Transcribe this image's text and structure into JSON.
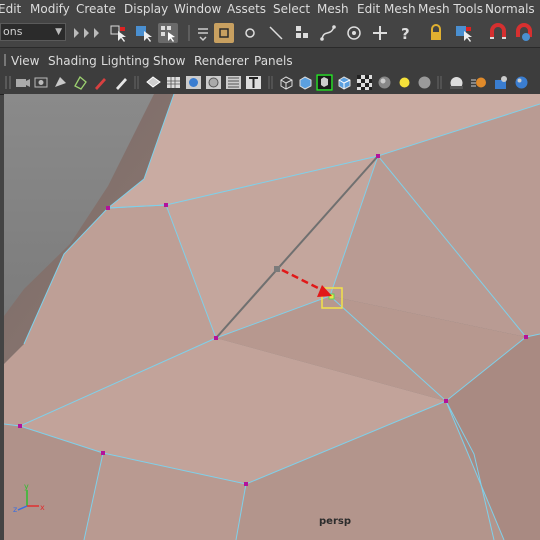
{
  "menu": [
    "Edit",
    "Modify",
    "Create",
    "Display",
    "Window",
    "Assets",
    "Select",
    "Mesh",
    "Edit Mesh",
    "Mesh Tools",
    "Normals"
  ],
  "mode_selector": {
    "value": "ons"
  },
  "panel_menu": [
    "View",
    "Shading",
    "Lighting",
    "Show",
    "Renderer",
    "Panels"
  ],
  "camera_label": "persp",
  "colors": {
    "selection_highlight": "#f2e24a",
    "annotation_arrow": "#e11818",
    "wire": "#7fd0ea",
    "vertex": "#b3129c",
    "mesh": "#bfa097"
  },
  "icons": {
    "shelf": [
      "select-tool-icon",
      "lasso-tool-icon",
      "paint-select-icon",
      "snap-grid-icon",
      "snap-curve-icon",
      "snap-point-icon",
      "make-live-icon",
      "history-icon",
      "render-icon",
      "ipr-render-icon",
      "render-settings-icon",
      "move-tool-icon",
      "rotate-tool-icon",
      "scale-tool-icon",
      "help-icon",
      "lock-icon",
      "pointer-icon",
      "magnet-icon"
    ],
    "panel": [
      "camera-icon",
      "wireframe-icon",
      "smooth-shade-icon",
      "xray-icon",
      "default-material-icon",
      "textured-icon",
      "lights-icon",
      "shadows-icon",
      "isolate-select-icon",
      "grid-icon"
    ]
  }
}
